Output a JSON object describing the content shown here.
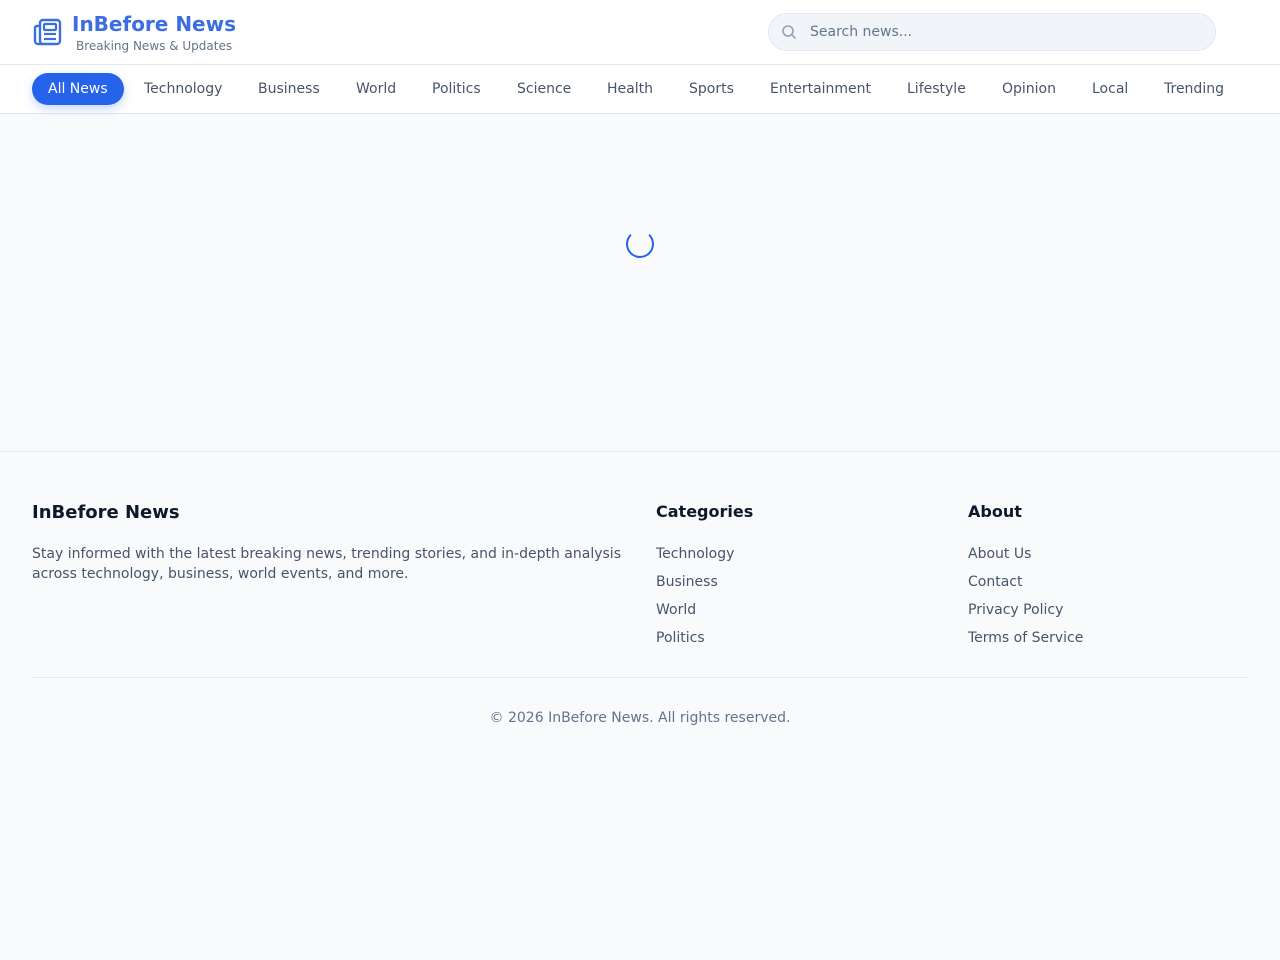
{
  "header": {
    "brand_title": "InBefore News",
    "brand_subtitle": "Breaking News & Updates",
    "search_placeholder": "Search news...",
    "accent_color": "#2563eb"
  },
  "nav": {
    "items": [
      {
        "label": "All News",
        "active": true
      },
      {
        "label": "Technology"
      },
      {
        "label": "Business"
      },
      {
        "label": "World"
      },
      {
        "label": "Politics"
      },
      {
        "label": "Science"
      },
      {
        "label": "Health"
      },
      {
        "label": "Sports"
      },
      {
        "label": "Entertainment"
      },
      {
        "label": "Lifestyle"
      },
      {
        "label": "Opinion"
      },
      {
        "label": "Local"
      },
      {
        "label": "Trending"
      }
    ]
  },
  "main": {
    "state": "loading"
  },
  "footer": {
    "brand_title": "InBefore News",
    "description": "Stay informed with the latest breaking news, trending stories, and in-depth analysis across technology, business, world events, and more.",
    "categories": {
      "title": "Categories",
      "links": [
        "Technology",
        "Business",
        "World",
        "Politics"
      ]
    },
    "about": {
      "title": "About",
      "links": [
        "About Us",
        "Contact",
        "Privacy Policy",
        "Terms of Service"
      ]
    },
    "copyright": "© 2026 InBefore News. All rights reserved."
  }
}
